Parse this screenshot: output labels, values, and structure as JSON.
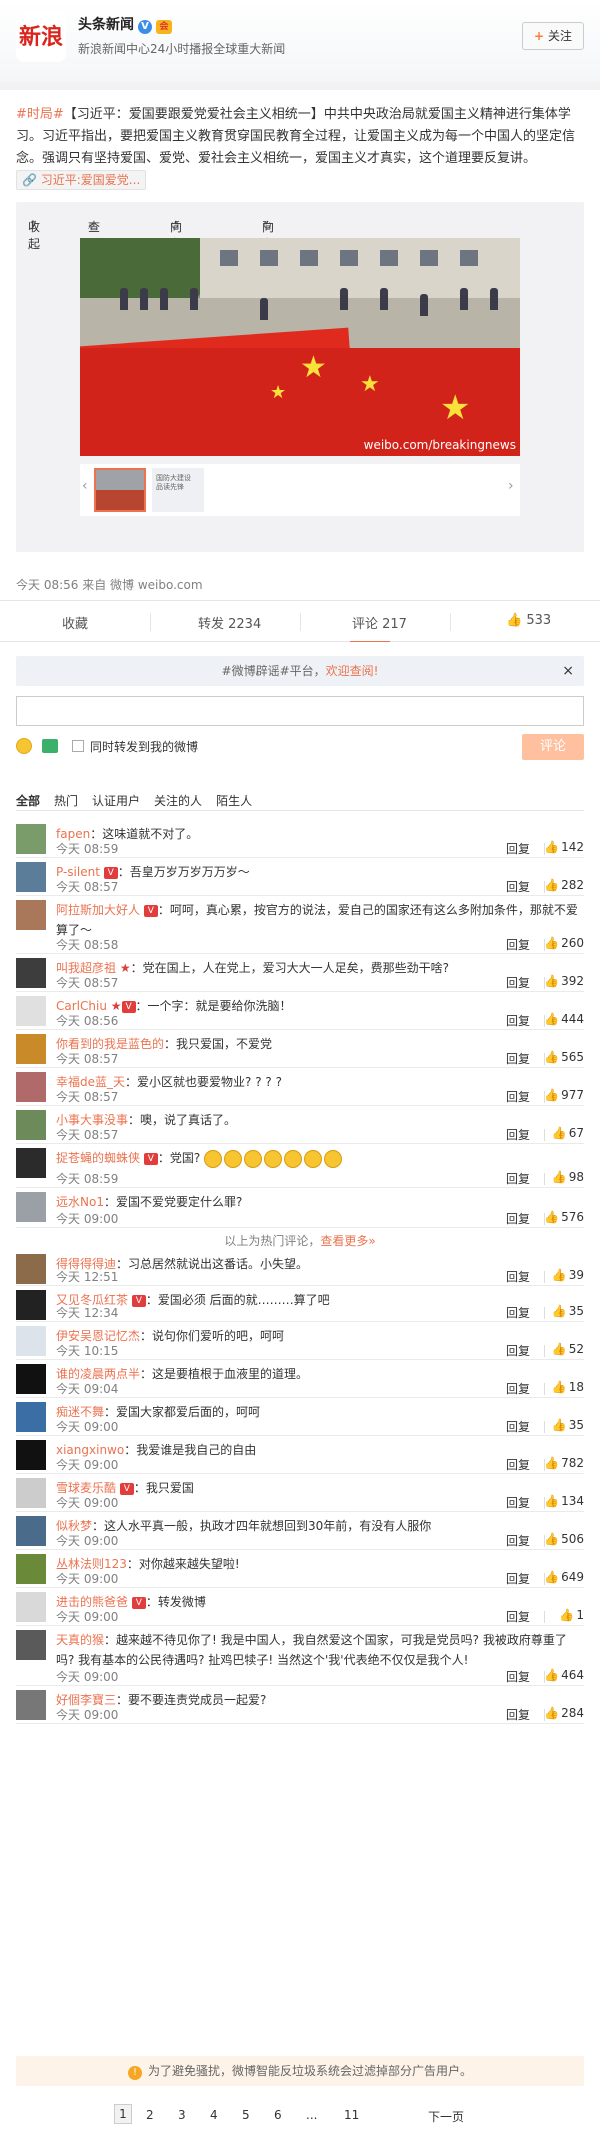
{
  "header": {
    "logo_text": "新浪",
    "account_name": "头条新闻",
    "verified_badge": "V",
    "member_badge": "会",
    "account_desc": "新浪新闻中心24小时播报全球重大新闻",
    "follow_label": "关注"
  },
  "post": {
    "tag": "#时局#",
    "title": "【习近平：爱国要跟爱党爱社会主义相统一】",
    "body": "中共中央政治局就爱国主义精神进行集体学习。习近平指出，要把爱国主义教育贯穿国民教育全过程，让爱国主义成为每一个中国人的坚定信念。强调只有坚持爱国、爱党、爱社会主义相统一，爱国主义才真实，这个道理要反复讲。",
    "topic_chip": "习近平:爱国爱党...",
    "toolbar": {
      "collapse": "收起",
      "view_large": "查看大图",
      "rotate_left": "向左旋转",
      "rotate_right": "向右旋转"
    },
    "watermark": "weibo.com/breakingnews",
    "thumb2_caption": "国防大建设\n品读先锋",
    "source": "今天 08:56 来自 微博 weibo.com"
  },
  "actions": {
    "favorite": "收藏",
    "repost": "转发 2234",
    "comment": "评论 217",
    "like": "533"
  },
  "comment_area": {
    "notice_prefix": "#微博辟谣#平台，",
    "notice_link": "欢迎查阅!",
    "repost_checkbox_label": "同时转发到我的微博",
    "submit_label": "评论",
    "filters": [
      "全部",
      "热门",
      "认证用户",
      "关注的人",
      "陌生人"
    ]
  },
  "comments": [
    {
      "user": "fapen",
      "text": "这味道就不对了。",
      "time": "今天 08:59",
      "likes": "142",
      "badges": ""
    },
    {
      "user": "P-silent",
      "text": "吾皇万岁万岁万万岁～",
      "time": "今天 08:57",
      "likes": "282",
      "badges": "vip"
    },
    {
      "user": "阿拉斯加大好人",
      "text": "呵呵，真心累，按官方的说法，爱自己的国家还有这么多附加条件，那就不爱算了～",
      "time": "今天 08:58",
      "likes": "260",
      "badges": "vip"
    },
    {
      "user": "叫我超彦祖",
      "text": "党在国上，人在党上，爱习大大一人足矣，费那些劲干啥?",
      "time": "今天 08:57",
      "likes": "392",
      "badges": "star"
    },
    {
      "user": "CarlChiu",
      "text": "一个字：就是要给你洗脑！",
      "time": "今天 08:56",
      "likes": "444",
      "badges": "star-vip"
    },
    {
      "user": "你看到的我是蓝色的",
      "text": "我只爱国，不爱党",
      "time": "今天 08:57",
      "likes": "565",
      "badges": ""
    },
    {
      "user": "幸福de蓝_天",
      "text": "爱小区就也要爱物业? ? ? ?",
      "time": "今天 08:57",
      "likes": "977",
      "badges": ""
    },
    {
      "user": "小事大事没事",
      "text": "噢，说了真话了。",
      "time": "今天 08:57",
      "likes": "67",
      "badges": ""
    },
    {
      "user": "捉苍蝇的蜘蛛侠",
      "text": "党国?",
      "time": "今天 08:59",
      "likes": "98",
      "badges": "vip",
      "smileys": 7
    },
    {
      "user": "远水No1",
      "text": "爱国不爱党要定什么罪?",
      "time": "今天 09:00",
      "likes": "576",
      "badges": ""
    }
  ],
  "hot_end": {
    "text": "以上为热门评论，",
    "more": "查看更多»"
  },
  "comments2": [
    {
      "user": "得得得得迪",
      "text": "习总居然就说出这番话。小失望。",
      "time": "今天 12:51",
      "likes": "39",
      "badges": ""
    },
    {
      "user": "又见冬瓜红茶",
      "text": "爱国必须 后面的就………算了吧",
      "time": "今天 12:34",
      "likes": "35",
      "badges": "vip"
    },
    {
      "user": "伊安吴恩记忆杰",
      "text": "说句你们爱听的吧，呵呵",
      "time": "今天 10:15",
      "likes": "52",
      "badges": ""
    },
    {
      "user": "谁的凌晨两点半",
      "text": "这是要植根于血液里的道理。",
      "time": "今天 09:04",
      "likes": "18",
      "badges": ""
    },
    {
      "user": "痴迷不舞",
      "text": "爱国大家都爱后面的，呵呵",
      "time": "今天 09:00",
      "likes": "35",
      "badges": ""
    },
    {
      "user": "xiangxinwo",
      "text": "我爱谁是我自己的自由",
      "time": "今天 09:00",
      "likes": "782",
      "badges": ""
    },
    {
      "user": "雪球麦乐酷",
      "text": "我只爱国",
      "time": "今天 09:00",
      "likes": "134",
      "badges": "vip"
    },
    {
      "user": "似秋梦",
      "text": "这人水平真一般，执政才四年就想回到30年前，有没有人服你",
      "time": "今天 09:00",
      "likes": "506",
      "badges": ""
    },
    {
      "user": "丛林法则123",
      "text": "对你越来越失望啦!",
      "time": "今天 09:00",
      "likes": "649",
      "badges": ""
    },
    {
      "user": "进击的熊爸爸",
      "text": "转发微博",
      "time": "今天 09:00",
      "likes": "1",
      "badges": "mvip",
      "reply_label": "回复"
    },
    {
      "user": "天真的猴",
      "text": "越来越不待见你了! 我是中国人，我自然爱这个国家，可我是党员吗? 我被政府尊重了吗? 我有基本的公民待遇吗? 扯鸡巴犊子! 当然这个'我'代表绝不仅仅是我个人!",
      "time": "今天 09:00",
      "likes": "464",
      "badges": ""
    },
    {
      "user": "好個李寶三",
      "text": "要不要连责党成员一起爱?",
      "time": "今天 09:00",
      "likes": "284",
      "badges": ""
    }
  ],
  "reply_label": "回复",
  "spam_notice": "为了避免骚扰，微博智能反垃圾系统会过滤掉部分广告用户。",
  "pager": {
    "pages": [
      "1",
      "2",
      "3",
      "4",
      "5",
      "6",
      "...",
      "11"
    ],
    "next": "下一页"
  },
  "colors": {
    "accent": "#eb7350",
    "flag_red": "#d2231a"
  }
}
